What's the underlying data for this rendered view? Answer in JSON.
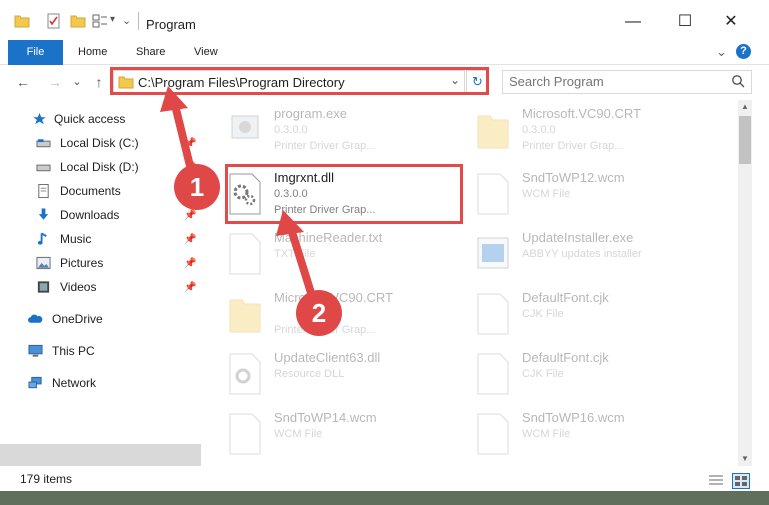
{
  "window": {
    "title": "Program",
    "minimize": "—",
    "maximize": "☐",
    "close": "✕"
  },
  "ribbon": {
    "tabs": [
      "File",
      "Home",
      "Share",
      "View"
    ],
    "expand": "⌄",
    "help": "?"
  },
  "address_bar": {
    "path": "C:\\Program Files\\Program Directory",
    "dropdown": "⌄",
    "refresh": "↻"
  },
  "nav": {
    "back": "←",
    "forward": "→",
    "recent": "⌄",
    "up": "↑"
  },
  "search": {
    "placeholder": "Search Program"
  },
  "sidebar": {
    "items": [
      {
        "label": "Quick access",
        "icon": "star-icon",
        "pinned": false
      },
      {
        "label": "Local Disk (C:)",
        "icon": "drive-icon",
        "pinned": true
      },
      {
        "label": "Local Disk (D:)",
        "icon": "drive-icon",
        "pinned": true
      },
      {
        "label": "Documents",
        "icon": "documents-icon",
        "pinned": true
      },
      {
        "label": "Downloads",
        "icon": "download-icon",
        "pinned": true
      },
      {
        "label": "Music",
        "icon": "music-icon",
        "pinned": true
      },
      {
        "label": "Pictures",
        "icon": "pictures-icon",
        "pinned": true
      },
      {
        "label": "Videos",
        "icon": "videos-icon",
        "pinned": true
      },
      {
        "label": "OneDrive",
        "icon": "cloud-icon",
        "pinned": false
      },
      {
        "label": "This PC",
        "icon": "computer-icon",
        "pinned": false
      },
      {
        "label": "Network",
        "icon": "network-icon",
        "pinned": false
      }
    ],
    "pin_glyph": "📌"
  },
  "files": [
    {
      "name": "program.exe",
      "line2": "0.3.0.0",
      "line3": "Printer Driver Grap...",
      "type": "exe"
    },
    {
      "name": "Microsoft.VC90.CRT",
      "line2": "0.3.0.0",
      "line3": "Printer Driver Grap...",
      "type": "folder"
    },
    {
      "name": "Imgrxnt.dll",
      "line2": "0.3.0.0",
      "line3": "Printer Driver Grap...",
      "type": "dll"
    },
    {
      "name": "SndToWP12.wcm",
      "line2": "WCM File",
      "line3": "",
      "type": "file"
    },
    {
      "name": "MachineReader.txt",
      "line2": "TXT File",
      "line3": "",
      "type": "file"
    },
    {
      "name": "UpdateInstaller.exe",
      "line2": "ABBYY updates installer",
      "line3": "",
      "type": "installer"
    },
    {
      "name": "Microsoft.VC90.CRT",
      "line2": "",
      "line3": "Printer Driver Grap...",
      "type": "folder"
    },
    {
      "name": "DefaultFont.cjk",
      "line2": "CJK File",
      "line3": "",
      "type": "file"
    },
    {
      "name": "UpdateClient63.dll",
      "line2": "Resource DLL",
      "line3": "",
      "type": "dll"
    },
    {
      "name": "DefaultFont.cjk",
      "line2": "CJK File",
      "line3": "",
      "type": "file"
    },
    {
      "name": "SndToWP14.wcm",
      "line2": "WCM File",
      "line3": "",
      "type": "file"
    },
    {
      "name": "SndToWP16.wcm",
      "line2": "WCM File",
      "line3": "",
      "type": "file"
    }
  ],
  "status": {
    "item_count": "179 items"
  },
  "annotations": {
    "step1": "1",
    "step2": "2",
    "highlight_color": "#e34a4a"
  },
  "colors": {
    "accent": "#1a73c8",
    "selected_bg": "#d9d9d9"
  }
}
